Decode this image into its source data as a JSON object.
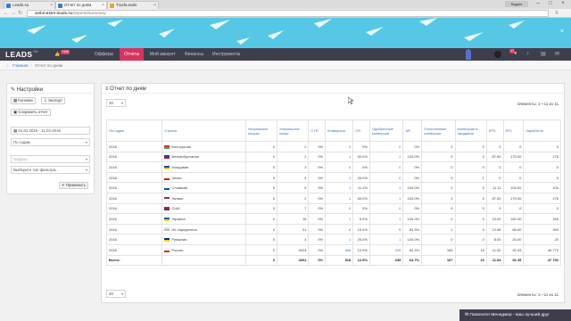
{
  "browser": {
    "tabs": [
      {
        "title": "Leads.su"
      },
      {
        "title": "Отчет по дням"
      },
      {
        "title": "TrackLeads"
      }
    ],
    "user_chip": "Вадим",
    "url_host": "webmaster.leads.su",
    "url_path": "/reports/summary"
  },
  "topnav": {
    "logo": "LEADS",
    "logo_sup": "SU",
    "balance_badge": "+106",
    "items": [
      "Офферы",
      "Отчеты",
      "Мой аккаунт",
      "Финансы",
      "Инструменты"
    ],
    "active_item": "Отчеты",
    "notif_badge": "17"
  },
  "breadcrumb": {
    "home": "Главная",
    "current": "Отчет по дням"
  },
  "settings": {
    "title": "Настройки",
    "columns_btn": "Колонки",
    "export_btn": "Экспорт",
    "save_btn": "Сохранить отчет",
    "date_range": "01.01.2016 - 11.04.2016",
    "group_by": "По годам",
    "offer_placeholder": "Оффер",
    "filter_placeholder": "Выберите тип фильтра...",
    "apply_btn": "Применить"
  },
  "report": {
    "title": "Отчет по дням",
    "page_size": "30",
    "elements_info": "Элементы: 1—11 из 11.",
    "columns": [
      "По годам",
      "Страна",
      "Уникальные показы",
      "Уникальные клики",
      "CTR",
      "Конверсии",
      "CR",
      "Одобренные конверсии",
      "AR",
      "Отклоненные конверсии",
      "Конверсии в ожидании",
      "EPC",
      "EPL",
      "Заработок"
    ],
    "rows": [
      [
        "2016",
        "Белоруссия",
        "0",
        "2",
        "0%",
        "0",
        "0%",
        "0",
        "0%",
        "0",
        "0",
        "0",
        "0",
        "0"
      ],
      [
        "2016",
        "Великобритания",
        "0",
        "2",
        "0%",
        "1",
        "50.0%",
        "1",
        "100.0%",
        "0",
        "0",
        "87.50",
        "175.00",
        "175"
      ],
      [
        "2016",
        "Молдавия",
        "0",
        "3",
        "0%",
        "0",
        "0%",
        "0",
        "0%",
        "0",
        "0",
        "0",
        "0",
        "0"
      ],
      [
        "2016",
        "Чехия",
        "0",
        "4",
        "0%",
        "1",
        "25.0%",
        "0",
        "0%",
        "0",
        "1",
        "0",
        "0",
        "0"
      ],
      [
        "2016",
        "Словакия",
        "0",
        "9",
        "0%",
        "1",
        "11.1%",
        "1",
        "100.0%",
        "0",
        "0",
        "11.11",
        "100.00",
        "100"
      ],
      [
        "2016",
        "Латвия",
        "0",
        "2",
        "0%",
        "1",
        "50.0%",
        "1",
        "100.0%",
        "0",
        "0",
        "87.50",
        "175.00",
        "175"
      ],
      [
        "2016",
        "США",
        "0",
        "7",
        "0%",
        "0",
        "0%",
        "0",
        "0%",
        "0",
        "0",
        "0",
        "0",
        "0"
      ],
      [
        "2016",
        "Украина",
        "0",
        "16",
        "0%",
        "1",
        "6.3%",
        "1",
        "100.0%",
        "0",
        "0",
        "10.00",
        "160.00",
        "160"
      ],
      [
        "2016",
        "Не определена",
        "0",
        "31",
        "0%",
        "6",
        "19.4%",
        "5",
        "83.3%",
        "1",
        "0",
        "12.58",
        "65.00",
        "390"
      ],
      [
        "2016",
        "Румыния",
        "0",
        "4",
        "0%",
        "1",
        "25.0%",
        "1",
        "100.0%",
        "0",
        "0",
        "5.00",
        "20.00",
        "20"
      ],
      [
        "2016",
        "Россия",
        "0",
        "3924",
        "0%",
        "506",
        "12.9%",
        "325",
        "64.2%",
        "165",
        "16",
        "11.92",
        "92.43",
        "46 772"
      ]
    ],
    "total_label": "Всего:",
    "total": [
      "",
      "",
      "0",
      "4004",
      "0%",
      "518",
      "12.9%",
      "335",
      "64.7%",
      "167",
      "16",
      "11.94",
      "92.35",
      "47 792"
    ]
  },
  "chat": {
    "label": "Помогите! Менеджер - ваш лучший друг"
  },
  "colors": {
    "banner": "#56c8e5",
    "nav": "#3e3e4d",
    "active": "#d6335f",
    "link": "#3a74c4"
  }
}
